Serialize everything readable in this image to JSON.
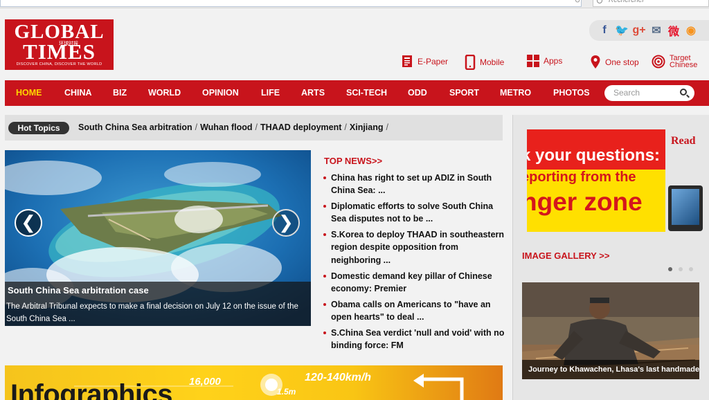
{
  "browser": {
    "search_placeholder": "Rechercher"
  },
  "logo": {
    "line1": "GLOBAL",
    "line2": "TIMES",
    "chinese": "环球时报",
    "tagline": "DISCOVER CHINA, DISCOVER THE WORLD"
  },
  "social": [
    {
      "name": "facebook-icon",
      "glyph": "f",
      "color": "#3b5998"
    },
    {
      "name": "twitter-icon",
      "glyph": "🐦",
      "color": "#1da1f2"
    },
    {
      "name": "google-plus-icon",
      "glyph": "g+",
      "color": "#dd4b39"
    },
    {
      "name": "email-icon",
      "glyph": "✉",
      "color": "#5a6f8a"
    },
    {
      "name": "weibo-icon",
      "glyph": "微",
      "color": "#e6162d"
    },
    {
      "name": "rss-icon",
      "glyph": "◉",
      "color": "#f7931e"
    }
  ],
  "header_links": {
    "epaper": "E-Paper",
    "mobile": "Mobile",
    "apps": "Apps",
    "onestop": "One stop",
    "target_line1": "Target",
    "target_line2": "Chinese"
  },
  "nav": {
    "items": [
      "HOME",
      "CHINA",
      "BIZ",
      "WORLD",
      "OPINION",
      "LIFE",
      "ARTS",
      "SCI-TECH",
      "ODD",
      "SPORT",
      "METRO",
      "PHOTOS"
    ],
    "search_placeholder": "Search"
  },
  "hot_topics": {
    "label": "Hot Topics",
    "items": [
      "South China Sea arbitration",
      "Wuhan flood",
      "THAAD deployment",
      "Xinjiang"
    ]
  },
  "slider": {
    "title": "South China Sea arbitration case",
    "description": "The Arbitral Tribunal expects to make a final decision on July 12 on the issue of the South China Sea ...",
    "prev_glyph": "❮",
    "next_glyph": "❯"
  },
  "top_news": {
    "title": "TOP NEWS>>",
    "items": [
      "China has right to set up ADIZ in South China Sea: ...",
      "Diplomatic efforts to solve South China Sea disputes not to be ...",
      "S.Korea to deploy THAAD in southeastern region despite opposition from neighboring ...",
      "Domestic demand key pillar of Chinese economy: Premier",
      "Obama calls on Americans to \"have an open hearts\" to deal ...",
      "S.China Sea verdict 'null and void' with no binding force: FM"
    ]
  },
  "infographics": {
    "title": "Infographics",
    "num1": "16,000",
    "num2": "120-140km/h",
    "num3": "1.5m"
  },
  "ad": {
    "line1": "k your questions:",
    "line2": "eporting from the",
    "line3": "nger zone",
    "read": "Read"
  },
  "gallery": {
    "title": "IMAGE GALLERY >>",
    "caption": "Journey to Khawachen, Lhasa's last handmade"
  },
  "colors": {
    "brand_red": "#c8141c",
    "nav_active": "#ffd500"
  }
}
